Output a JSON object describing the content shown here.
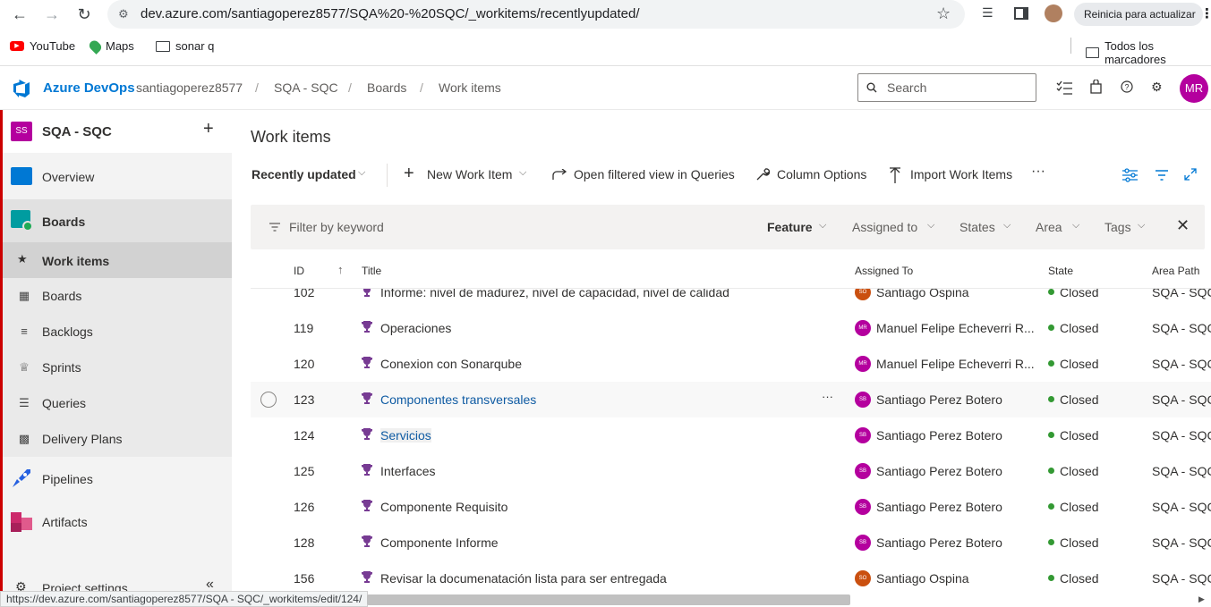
{
  "browser": {
    "url": "dev.azure.com/santiagoperez8577/SQA%20-%20SQC/_workitems/recentlyupdated/",
    "update_button": "Reinicia para actualizar",
    "bookmarks": [
      "YouTube",
      "Maps",
      "sonar q"
    ],
    "all_bookmarks": "Todos los marcadores"
  },
  "header": {
    "brand": "Azure DevOps",
    "crumbs": [
      "santiagoperez8577",
      "SQA - SQC",
      "Boards",
      "Work items"
    ],
    "search_placeholder": "Search",
    "avatar": "MR"
  },
  "sidebar": {
    "project_badge": "SS",
    "project": "SQA - SQC",
    "add": "+",
    "items": [
      {
        "label": "Overview",
        "icon": "overview-icon"
      },
      {
        "label": "Boards",
        "icon": "boards-icon"
      },
      {
        "label": "Work items",
        "icon": "work-items-icon"
      },
      {
        "label": "Boards",
        "icon": "boards-sub-icon"
      },
      {
        "label": "Backlogs",
        "icon": "backlogs-icon"
      },
      {
        "label": "Sprints",
        "icon": "sprints-icon"
      },
      {
        "label": "Queries",
        "icon": "queries-icon"
      },
      {
        "label": "Delivery Plans",
        "icon": "delivery-plans-icon"
      },
      {
        "label": "Pipelines",
        "icon": "pipelines-icon"
      },
      {
        "label": "Artifacts",
        "icon": "artifacts-icon"
      },
      {
        "label": "Project settings",
        "icon": "gear-icon"
      }
    ],
    "collapse": "«"
  },
  "main": {
    "title": "Work items",
    "toolbar": {
      "view": "Recently updated",
      "new_item": "New Work Item",
      "open_queries": "Open filtered view in Queries",
      "column_options": "Column Options",
      "import": "Import Work Items",
      "more": "···"
    },
    "filter": {
      "placeholder": "Filter by keyword",
      "feature": "Feature",
      "assigned": "Assigned to",
      "states": "States",
      "area": "Area",
      "tags": "Tags"
    },
    "columns": {
      "id": "ID",
      "title": "Title",
      "assigned": "Assigned To",
      "state": "State",
      "area": "Area Path"
    },
    "rows": [
      {
        "id": "102",
        "title": "Informe: nivel de madurez, nivel de capacidad, nivel de calidad",
        "initials": "SO",
        "assigned": "Santiago Ospina",
        "state": "Closed",
        "area": "SQA - SQC"
      },
      {
        "id": "119",
        "title": "Operaciones",
        "initials": "MR",
        "assigned": "Manuel Felipe Echeverri R...",
        "state": "Closed",
        "area": "SQA - SQC"
      },
      {
        "id": "120",
        "title": "Conexion con Sonarqube",
        "initials": "MR",
        "assigned": "Manuel Felipe Echeverri R...",
        "state": "Closed",
        "area": "SQA - SQC"
      },
      {
        "id": "123",
        "title": "Componentes transversales",
        "initials": "SB",
        "assigned": "Santiago Perez Botero",
        "state": "Closed",
        "area": "SQA - SQC"
      },
      {
        "id": "124",
        "title": "Servicios",
        "initials": "SB",
        "assigned": "Santiago Perez Botero",
        "state": "Closed",
        "area": "SQA - SQC"
      },
      {
        "id": "125",
        "title": "Interfaces",
        "initials": "SB",
        "assigned": "Santiago Perez Botero",
        "state": "Closed",
        "area": "SQA - SQC"
      },
      {
        "id": "126",
        "title": "Componente Requisito",
        "initials": "SB",
        "assigned": "Santiago Perez Botero",
        "state": "Closed",
        "area": "SQA - SQC"
      },
      {
        "id": "128",
        "title": "Componente Informe",
        "initials": "SB",
        "assigned": "Santiago Perez Botero",
        "state": "Closed",
        "area": "SQA - SQC"
      },
      {
        "id": "156",
        "title": "Revisar la documenatación lista para ser entregada",
        "initials": "SO",
        "assigned": "Santiago Ospina",
        "state": "Closed",
        "area": "SQA - SQC"
      }
    ],
    "row_more": "···"
  },
  "status_url": "https://dev.azure.com/santiagoperez8577/SQA - SQC/_workitems/edit/124/",
  "colors": {
    "accent": "#0078d4",
    "avatar_mr": "#b4009e",
    "avatar_so": "#ca5010",
    "avatar_sb": "#b4009e",
    "closed": "#339933",
    "trophy": "#773b93"
  }
}
